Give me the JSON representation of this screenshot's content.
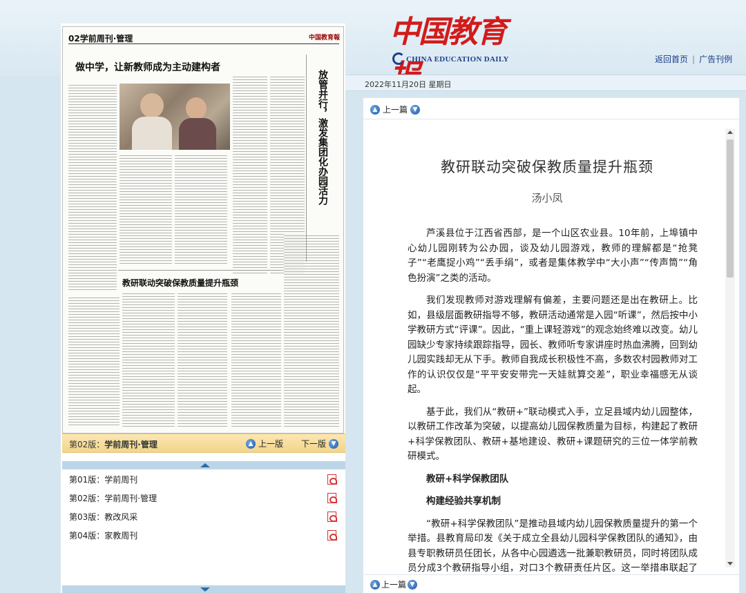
{
  "masthead": {
    "logo_cn": "中国教育报",
    "logo_en": "CHINA EDUCATION DAILY",
    "links": [
      "返回首页",
      "广告刊例"
    ]
  },
  "date": "2022年11月20日  星期日",
  "newspaper": {
    "page_header": "02学前周刊·管理",
    "brand": "中国教育報",
    "headline_top": "做中学，让新教师成为主动建构者",
    "headline_vertical": "放管并行，激发集团化办园活力",
    "headline_middle": "教研联动突破保教质量提升瓶颈"
  },
  "edition_bar": {
    "label_prefix": "第02版：",
    "label_name": "学前周刊·管理",
    "prev": "上一版",
    "next": "下一版"
  },
  "editions": [
    {
      "label": "第01版：学前周刊"
    },
    {
      "label": "第02版：学前周刊·管理"
    },
    {
      "label": "第03版：教改风采"
    },
    {
      "label": "第04版：家教周刊"
    }
  ],
  "article": {
    "prev_article": "上一篇",
    "title": "教研联动突破保教质量提升瓶颈",
    "author": "汤小凤",
    "paragraphs": [
      "芦溪县位于江西省西部，是一个山区农业县。10年前，上埠镇中心幼儿园刚转为公办园，谈及幼儿园游戏，教师的理解都是“抢凳子”“老鹰捉小鸡”“丢手绢”，或者是集体教学中“大小声”“传声筒”“角色扮演”之类的活动。",
      "我们发现教师对游戏理解有偏差，主要问题还是出在教研上。比如，县级层面教研指导不够，教研活动通常是入园“听课”，然后按中小学教研方式“评课”。因此，“重上课轻游戏”的观念始终难以改变。幼儿园缺少专家持续跟踪指导，园长、教师听专家讲座时热血沸腾，回到幼儿园实践却无从下手。教师自我成长积极性不高，多数农村园教师对工作的认识仅仅是“平平安安带完一天娃就算交差”，职业幸福感无从谈起。",
      "基于此，我们从“教研+”联动模式入手，立足县域内幼儿园整体，以教研工作改革为突破，以提高幼儿园保教质量为目标，构建起了教研+科学保教团队、教研+基地建设、教研+课题研究的三位一体学前教研模式。"
    ],
    "heading1": "教研+科学保教团队",
    "heading2": "构建经验共享机制",
    "paragraph4": "“教研+科学保教团队”是推动县域内幼儿园保教质量提升的第一个举措。县教育局印发《关于成立全县幼儿园科学保教团队的通知》，由县专职教研员任团长，从各中心园遴选一批兼职教研员，同时将团队成员分成3个教研指导小组，对口3个教研责任片区。这一举措串联起了县域内所有幼儿园，改变了以往幼儿园各自为政、关门办园的状况，构建起了教研协助、经验共享的内部联动机制。"
  }
}
